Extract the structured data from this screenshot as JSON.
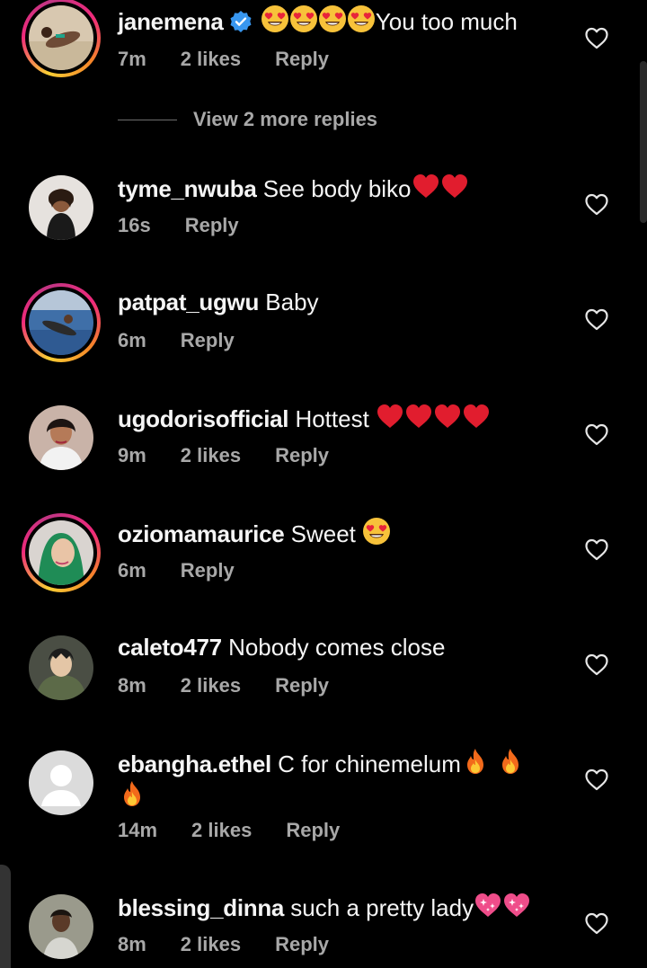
{
  "view_more": "View 2 more replies",
  "comments": [
    {
      "username": "janemena",
      "verified": true,
      "text": "You too much",
      "emoji_before": [
        "heart-eyes",
        "heart-eyes",
        "heart-eyes",
        "heart-eyes"
      ],
      "time": "7m",
      "likes": "2 likes",
      "reply": "Reply",
      "story_ring": true
    },
    {
      "username": "tyme_nwuba",
      "text": "See body biko",
      "emoji_after": [
        "red-heart",
        "red-heart"
      ],
      "time": "16s",
      "reply": "Reply",
      "story_ring": false
    },
    {
      "username": "patpat_ugwu",
      "text": "Baby",
      "time": "6m",
      "reply": "Reply",
      "story_ring": true
    },
    {
      "username": "ugodorisofficial",
      "text": "Hottest",
      "emoji_after": [
        "red-heart",
        "red-heart",
        "red-heart",
        "red-heart"
      ],
      "time": "9m",
      "likes": "2 likes",
      "reply": "Reply",
      "story_ring": false
    },
    {
      "username": "oziomamaurice",
      "text": "Sweet",
      "emoji_after": [
        "heart-eyes"
      ],
      "time": "6m",
      "reply": "Reply",
      "story_ring": true
    },
    {
      "username": "caleto477",
      "text": "Nobody comes close",
      "time": "8m",
      "likes": "2 likes",
      "reply": "Reply",
      "story_ring": false
    },
    {
      "username": "ebangha.ethel",
      "text": "C for chinemelum",
      "emoji_after": [
        "fire",
        "fire",
        "fire"
      ],
      "time": "14m",
      "likes": "2 likes",
      "reply": "Reply",
      "story_ring": false
    },
    {
      "username": "blessing_dinna",
      "text": "such a pretty lady",
      "emoji_after": [
        "sparkling-heart",
        "sparkling-heart"
      ],
      "time": "8m",
      "likes": "2 likes",
      "reply": "Reply",
      "story_ring": false
    }
  ],
  "colors": {
    "background": "#000000",
    "text": "#f5f5f5",
    "meta": "#a8a8a8",
    "verified": "#3897f0",
    "heart": "#ed2f2f"
  }
}
